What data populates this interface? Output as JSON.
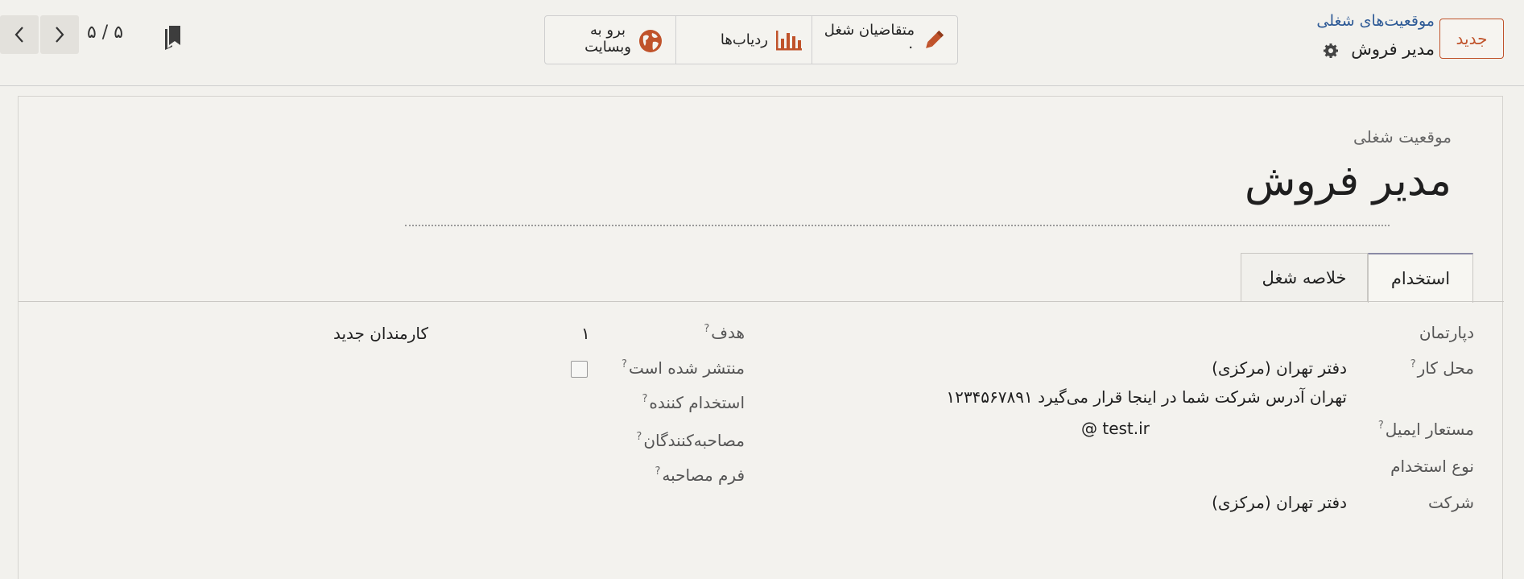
{
  "control_panel": {
    "new_button": "جدید",
    "breadcrumb": {
      "parent": "موقعیت‌های شغلی",
      "current": "مدیر فروش"
    },
    "smart_buttons": {
      "applicants": {
        "label": "متقاضیان شغل",
        "count": "۰",
        "icon": "pencil-icon"
      },
      "trackers": {
        "label": "ردیاب‌ها",
        "icon": "bar-chart-icon"
      },
      "website": {
        "line1": "برو به",
        "line2": "وبسایت",
        "icon": "globe-icon"
      }
    },
    "pager": {
      "value": "۵ / ۵"
    },
    "colors": {
      "accent": "#c0532b",
      "link": "#2e5a96"
    }
  },
  "form": {
    "title_label": "موقعیت شغلی",
    "title": "مدیر فروش",
    "tabs": [
      {
        "label": "استخدام",
        "active": true
      },
      {
        "label": "خلاصه شغل",
        "active": false
      }
    ],
    "right_column": {
      "department": {
        "label": "دپارتمان",
        "value": ""
      },
      "job_location": {
        "label": "محل کار",
        "help": "?",
        "value": "دفتر تهران (مرکزی)",
        "address": "تهران آدرس شرکت شما در اینجا قرار می‌گیرد ۱۲۳۴۵۶۷۸۹۱"
      },
      "email_alias": {
        "label": "مستعار ایمیل",
        "help": "?",
        "value": "@ test.ir"
      },
      "employment_type": {
        "label": "نوع استخدام",
        "value": ""
      },
      "company": {
        "label": "شرکت",
        "value": "دفتر تهران (مرکزی)"
      }
    },
    "left_column": {
      "target": {
        "label": "هدف",
        "help": "?",
        "value": "۱",
        "unit": "کارمندان جدید"
      },
      "is_published": {
        "label": "منتشر شده است",
        "help": "?",
        "checked": false
      },
      "recruiter": {
        "label": "استخدام کننده",
        "help": "?",
        "value": ""
      },
      "interviewers": {
        "label": "مصاحبه‌کنندگان",
        "help": "?",
        "value": ""
      },
      "interview_form": {
        "label": "فرم مصاحبه",
        "help": "?",
        "value": ""
      }
    }
  }
}
